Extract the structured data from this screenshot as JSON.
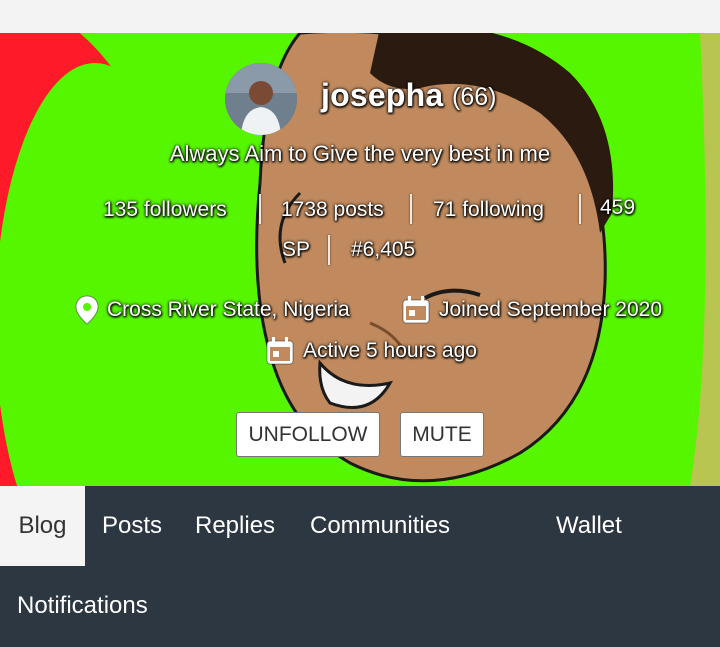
{
  "profile": {
    "username": "josepha",
    "reputation": "(66)",
    "about": "Always Aim to Give the very best in me",
    "stats": {
      "followers": "135 followers",
      "posts": "1738 posts",
      "following": "71 following",
      "sp_part1": "459",
      "sp_part2": "SP",
      "rank": "#6,405"
    },
    "location": "Cross River State, Nigeria",
    "joined": "Joined September 2020",
    "active": "Active 5 hours ago"
  },
  "actions": {
    "unfollow": "UNFOLLOW",
    "mute": "MUTE"
  },
  "tabs": [
    {
      "label": "Blog",
      "active": true
    },
    {
      "label": "Posts",
      "active": false
    },
    {
      "label": "Replies",
      "active": false
    },
    {
      "label": "Communities",
      "active": false
    },
    {
      "label": "Wallet",
      "active": false
    },
    {
      "label": "Notifications",
      "active": false
    }
  ],
  "colors": {
    "cover_green": "#56f500",
    "cover_red": "#ff1a2a",
    "skin": "#c08a5e",
    "nav_bg": "#2c3741",
    "active_tab_bg": "#f4f4f4"
  },
  "icons": {
    "location": "map-pin-icon",
    "joined": "calendar-icon",
    "active": "calendar-icon"
  }
}
